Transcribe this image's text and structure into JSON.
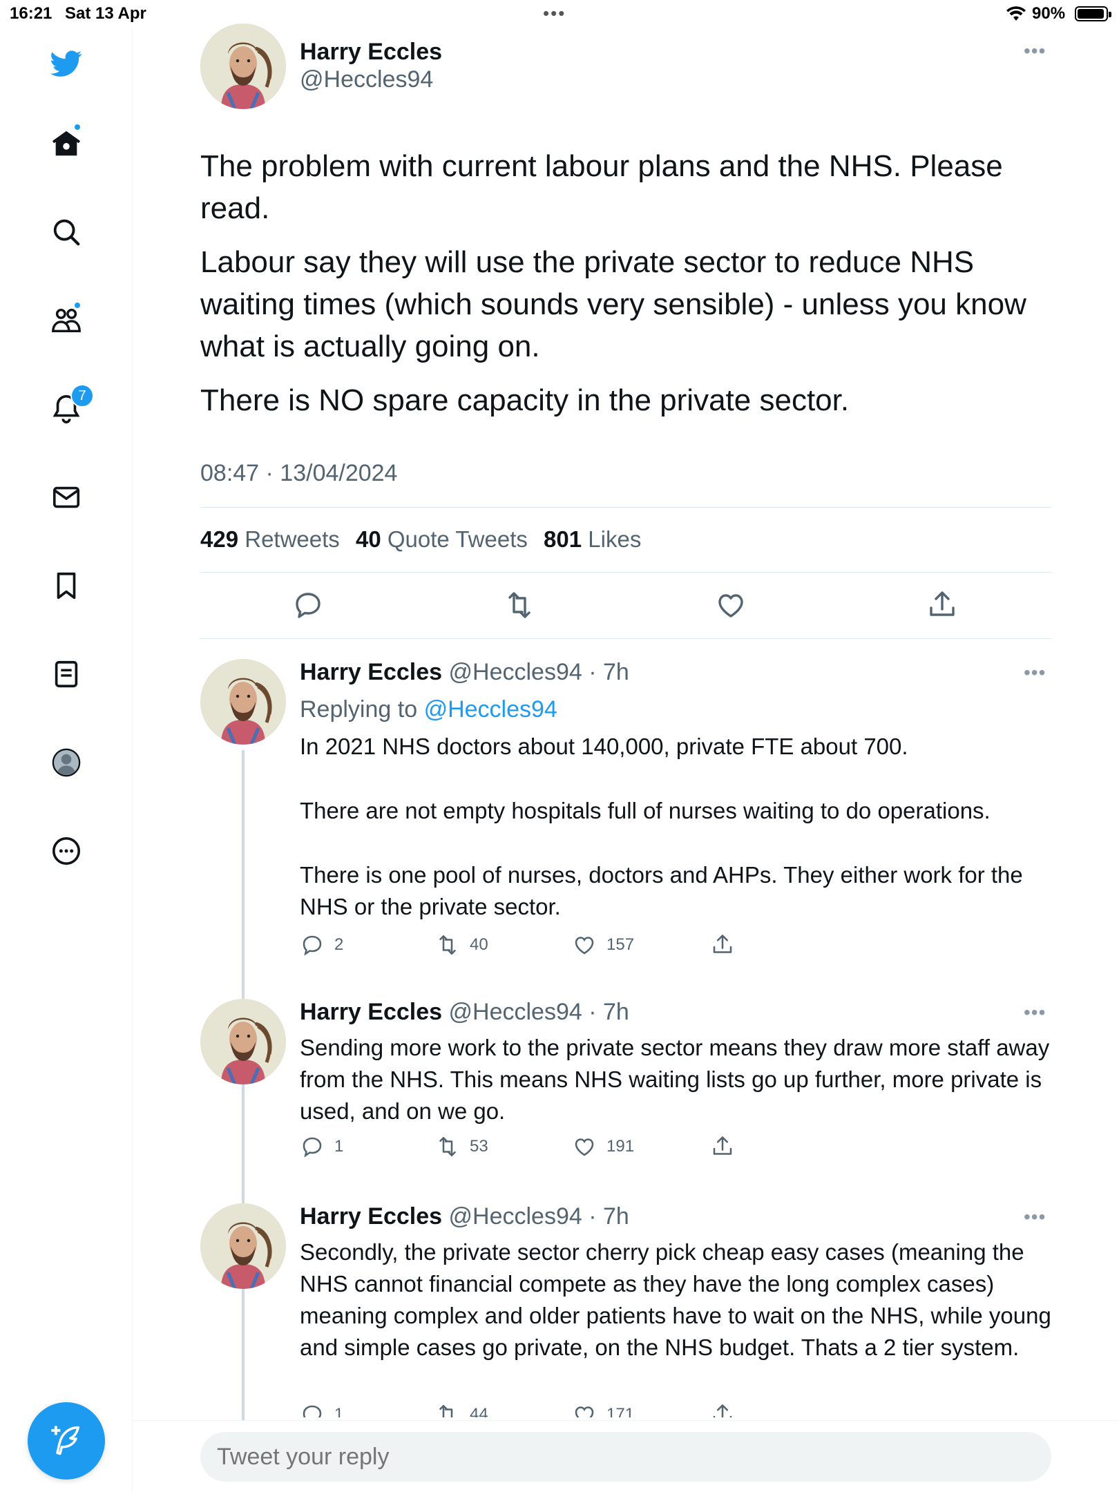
{
  "status_bar": {
    "time": "16:21",
    "date": "Sat 13 Apr",
    "battery": "90%"
  },
  "sidebar": {
    "notification_count": "7"
  },
  "tweet": {
    "author_name": "Harry Eccles",
    "author_handle": "@Heccles94",
    "paragraphs": [
      "The problem with current labour plans and the NHS. Please read.",
      "Labour say they will use the private sector to reduce NHS waiting times (which sounds very sensible) - unless you know what is actually going on.",
      "There is NO spare capacity in the private sector."
    ],
    "timestamp": "08:47 · 13/04/2024",
    "stats": {
      "retweets": "429",
      "retweets_label": "Retweets",
      "quotes": "40",
      "quotes_label": "Quote Tweets",
      "likes": "801",
      "likes_label": "Likes"
    }
  },
  "replies": [
    {
      "name": "Harry Eccles",
      "handle": "@Heccles94",
      "time": "· 7h",
      "replying_to_label": "Replying to",
      "replying_to": "@Heccles94",
      "paragraphs": [
        "In 2021 NHS doctors about 140,000, private FTE about 700.",
        "There are not empty hospitals full of nurses waiting to do operations.",
        "There is one pool of nurses, doctors and AHPs. They either work for the NHS or the private sector."
      ],
      "replies": "2",
      "retweets": "40",
      "likes": "157"
    },
    {
      "name": "Harry Eccles",
      "handle": "@Heccles94",
      "time": "· 7h",
      "paragraphs": [
        "Sending more work to the private sector means they draw more staff away from the NHS. This means NHS waiting lists go up further, more private is used, and on we go."
      ],
      "replies": "1",
      "retweets": "53",
      "likes": "191"
    },
    {
      "name": "Harry Eccles",
      "handle": "@Heccles94",
      "time": "· 7h",
      "paragraphs": [
        "Secondly, the private sector cherry pick cheap easy cases (meaning the NHS cannot financial compete as they have the long complex cases) meaning  complex and older patients have to wait on the NHS, while young and simple cases go private, on the NHS budget. Thats a 2 tier system."
      ],
      "replies": "1",
      "retweets": "44",
      "likes": "171"
    }
  ],
  "reply_input": {
    "placeholder": "Tweet your reply"
  },
  "colors": {
    "accent": "#1d9bf0",
    "text": "#0f1419",
    "muted": "#536471"
  }
}
